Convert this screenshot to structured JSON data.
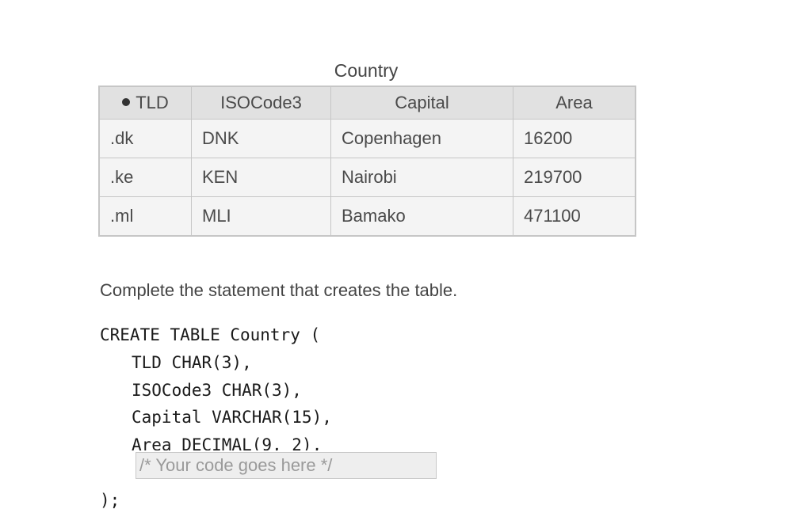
{
  "table": {
    "caption": "Country",
    "columns": [
      "TLD",
      "ISOCode3",
      "Capital",
      "Area"
    ],
    "primary_key_marker": "●",
    "rows": [
      [
        ".dk",
        "DNK",
        "Copenhagen",
        "16200"
      ],
      [
        ".ke",
        "KEN",
        "Nairobi",
        "219700"
      ],
      [
        ".ml",
        "MLI",
        "Bamako",
        "471100"
      ]
    ]
  },
  "prompt": "Complete the statement that creates the table.",
  "code": {
    "line1": "CREATE TABLE Country (",
    "line2": "TLD CHAR(3),",
    "line3": "ISOCode3 CHAR(3),",
    "line4": "Capital VARCHAR(15),",
    "line5": "Area DECIMAL(9, 2),",
    "end": ");"
  },
  "answer_input": {
    "value": "",
    "placeholder": "/* Your code goes here */"
  }
}
